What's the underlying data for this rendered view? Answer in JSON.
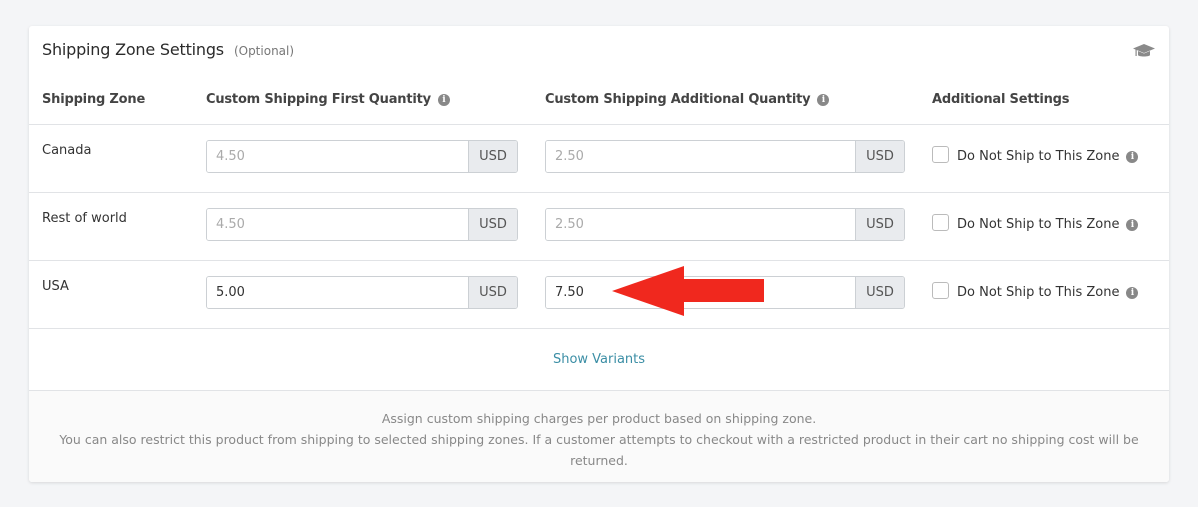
{
  "card": {
    "title": "Shipping Zone Settings",
    "optional": "(Optional)",
    "header_icon": "graduation-cap-icon"
  },
  "table": {
    "headers": [
      "Shipping Zone",
      "Custom Shipping First Quantity",
      "Custom Shipping Additional Quantity",
      "Additional Settings"
    ],
    "rows": [
      {
        "zone": "Canada",
        "first": {
          "value": "",
          "placeholder": "4.50",
          "currency": "USD"
        },
        "additional": {
          "value": "",
          "placeholder": "2.50",
          "currency": "USD"
        },
        "do_not_ship": {
          "label": "Do Not Ship to This Zone",
          "checked": false
        }
      },
      {
        "zone": "Rest of world",
        "first": {
          "value": "",
          "placeholder": "4.50",
          "currency": "USD"
        },
        "additional": {
          "value": "",
          "placeholder": "2.50",
          "currency": "USD"
        },
        "do_not_ship": {
          "label": "Do Not Ship to This Zone",
          "checked": false
        }
      },
      {
        "zone": "USA",
        "first": {
          "value": "5.00",
          "placeholder": "",
          "currency": "USD"
        },
        "additional": {
          "value": "7.50",
          "placeholder": "",
          "currency": "USD"
        },
        "do_not_ship": {
          "label": "Do Not Ship to This Zone",
          "checked": false
        }
      }
    ]
  },
  "show_variants": "Show Variants",
  "footer": {
    "line1": "Assign custom shipping charges per product based on shipping zone.",
    "line2": "You can also restrict this product from shipping to selected shipping zones. If a customer attempts to checkout with a restricted product in their cart no shipping cost will be returned."
  },
  "annotation": {
    "type": "arrow",
    "direction": "left",
    "color": "#f0281e",
    "points_to": "USA additional quantity input"
  },
  "colors": {
    "link": "#3b8ea5",
    "background": "#f4f5f7"
  }
}
